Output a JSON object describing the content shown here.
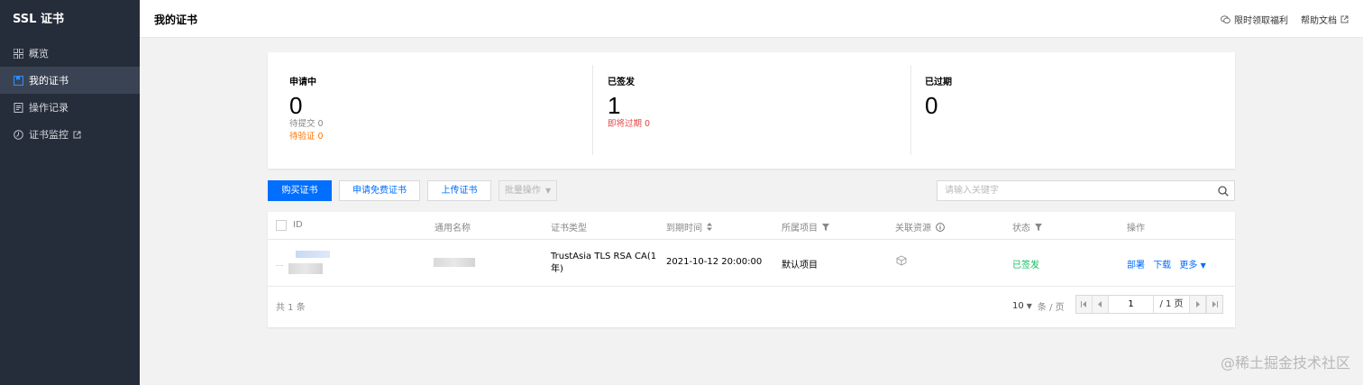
{
  "sidebar": {
    "brand": "SSL 证书",
    "items": [
      {
        "label": "概览",
        "icon": "grid-icon"
      },
      {
        "label": "我的证书",
        "icon": "certificate-icon",
        "active": true
      },
      {
        "label": "操作记录",
        "icon": "document-icon"
      },
      {
        "label": "证书监控",
        "icon": "monitor-icon",
        "external": true
      }
    ]
  },
  "header": {
    "title": "我的证书",
    "promo_link": "限时领取福利",
    "help_link": "帮助文档"
  },
  "stats": [
    {
      "label": "申请中",
      "value": "0",
      "subs": [
        "待提交 0",
        "待验证 0"
      ]
    },
    {
      "label": "已签发",
      "value": "1",
      "subs": [
        "即将过期 0"
      ]
    },
    {
      "label": "已过期",
      "value": "0",
      "subs": []
    }
  ],
  "toolbar": {
    "buy_label": "购买证书",
    "apply_free_label": "申请免费证书",
    "upload_label": "上传证书",
    "batch_label": "批量操作",
    "search_placeholder": "请输入关键字"
  },
  "table": {
    "columns": [
      "ID",
      "通用名称",
      "证书类型",
      "到期时间",
      "所属项目",
      "关联资源",
      "状态",
      "操作"
    ],
    "rows": [
      {
        "cert_type_line1": "TrustAsia TLS RSA CA(1",
        "cert_type_line2": "年)",
        "expires": "2021-10-12 20:00:00",
        "project": "默认项目",
        "status": "已签发",
        "actions": [
          "部署",
          "下载",
          "更多"
        ]
      }
    ],
    "total": "共 1 条",
    "page_size": "10",
    "page_size_unit": "条 / 页",
    "current_page": "1",
    "total_pages": "/ 1 页"
  },
  "watermark": "@稀土掘金技术社区",
  "colors": {
    "sidebar_bg": "#262d3a",
    "primary": "#006eff",
    "success": "#0abf5b",
    "warning": "#ff7200",
    "danger": "#e54545"
  }
}
